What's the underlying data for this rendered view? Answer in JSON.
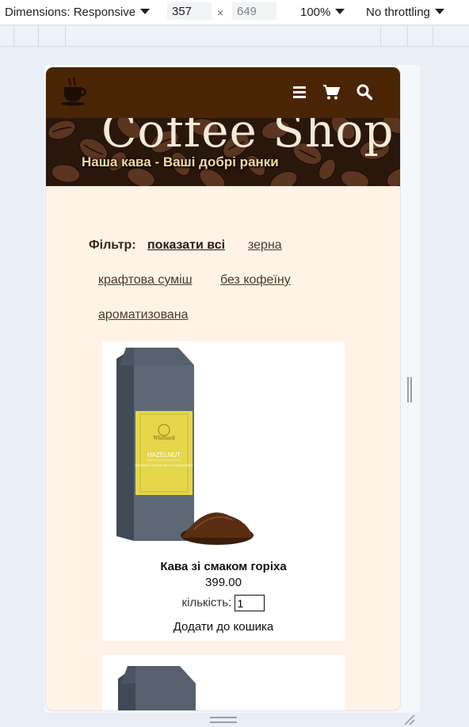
{
  "devtools": {
    "dimensions_label": "Dimensions: Responsive",
    "width_value": "357",
    "height_value": "649",
    "times_symbol": "×",
    "zoom": "100%",
    "throttling": "No throttling"
  },
  "header": {
    "logo_icon": "coffee-cup-logo",
    "menu_icon": "hamburger-menu-icon",
    "cart_icon": "cart-icon",
    "search_icon": "search-icon",
    "bg_color": "#4a2505"
  },
  "hero": {
    "title": "Coffee Shop",
    "subtitle": "Наша кава - Ваші добрі ранки"
  },
  "filter": {
    "label": "Фільтр:",
    "options": [
      {
        "label": "показати всі",
        "active": true
      },
      {
        "label": "зерна",
        "active": false
      },
      {
        "label": "крафтова суміш",
        "active": false
      },
      {
        "label": "без кофеїну",
        "active": false
      },
      {
        "label": "ароматизована",
        "active": false
      }
    ]
  },
  "products": [
    {
      "name": "Кава зі смаком горіха",
      "price": "399.00",
      "quantity_label": "кількість:",
      "quantity_value": "1",
      "add_label": "Додати до кошика",
      "package_label": "HAZELNUT",
      "package_sub": "GROUND COFFEE WITH FLAVOURING",
      "brand": "Whittard"
    }
  ]
}
